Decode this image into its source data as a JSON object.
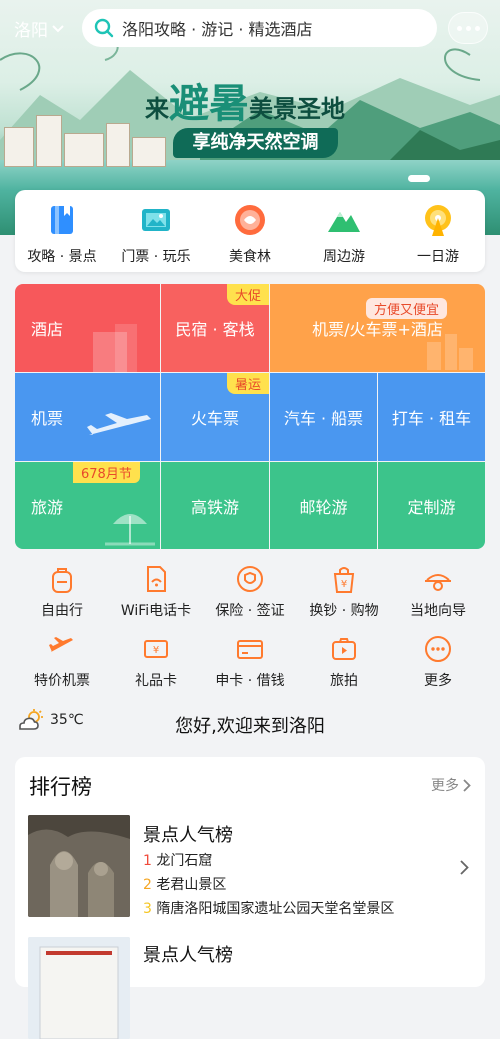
{
  "header": {
    "city": "洛阳",
    "search_placeholder": "洛阳攻略 · 游记 · 精选酒店"
  },
  "banner": {
    "title_pre": "来",
    "title_big": "避暑",
    "title_post": "美景圣地",
    "subtitle": "享纯净天然空调"
  },
  "quick_nav": [
    {
      "label": "攻略 · 景点",
      "icon": "guide-book-icon",
      "color": "#2f8fff"
    },
    {
      "label": "门票 · 玩乐",
      "icon": "ticket-icon",
      "color": "#21b4c8"
    },
    {
      "label": "美食林",
      "icon": "food-icon",
      "color": "#ff6b3d"
    },
    {
      "label": "周边游",
      "icon": "mountain-icon",
      "color": "#2fbf71"
    },
    {
      "label": "一日游",
      "icon": "ferris-wheel-icon",
      "color": "#ffc21a"
    }
  ],
  "grid": {
    "hotel": "酒店",
    "homestay": "民宿 · 客栈",
    "homestay_tag": "大促",
    "flight_train_hotel": "机票/火车票+酒店",
    "flight_train_hotel_tag": "方便又便宜",
    "flight": "机票",
    "train": "火车票",
    "train_tag": "暑运",
    "bus_ship": "汽车 · 船票",
    "taxi": "打车 · 租车",
    "travel": "旅游",
    "travel_tag": "678月节",
    "hsr": "高铁游",
    "cruise": "邮轮游",
    "custom": "定制游",
    "colors": {
      "red": "#f7585b",
      "orange": "#ffa24a",
      "blue": "#4a97f0",
      "green": "#3cc48b"
    }
  },
  "services": [
    {
      "label": "自由行",
      "icon": "backpack-icon"
    },
    {
      "label": "WiFi电话卡",
      "icon": "wifi-card-icon"
    },
    {
      "label": "保险 · 签证",
      "icon": "shield-icon"
    },
    {
      "label": "换钞 · 购物",
      "icon": "currency-bag-icon"
    },
    {
      "label": "当地向导",
      "icon": "guide-hat-icon"
    },
    {
      "label": "特价机票",
      "icon": "plane-icon"
    },
    {
      "label": "礼品卡",
      "icon": "gift-card-icon"
    },
    {
      "label": "申卡 · 借钱",
      "icon": "credit-card-icon"
    },
    {
      "label": "旅拍",
      "icon": "camera-icon"
    },
    {
      "label": "更多",
      "icon": "more-dots-icon"
    }
  ],
  "weather": {
    "temp": "35℃",
    "icon": "partly-sunny-icon"
  },
  "greeting": "您好,欢迎来到洛阳",
  "ranking": {
    "title": "排行榜",
    "more": "更多",
    "lists": [
      {
        "heading": "景点人气榜",
        "items": [
          {
            "rank": "1",
            "name": "龙门石窟"
          },
          {
            "rank": "2",
            "name": "老君山景区"
          },
          {
            "rank": "3",
            "name": "隋唐洛阳城国家遗址公园天堂名堂景区"
          }
        ]
      },
      {
        "heading": "景点人气榜"
      }
    ],
    "rank_colors": {
      "1": "#f04b3b",
      "2": "#f5a623",
      "3": "#f5c623"
    }
  }
}
